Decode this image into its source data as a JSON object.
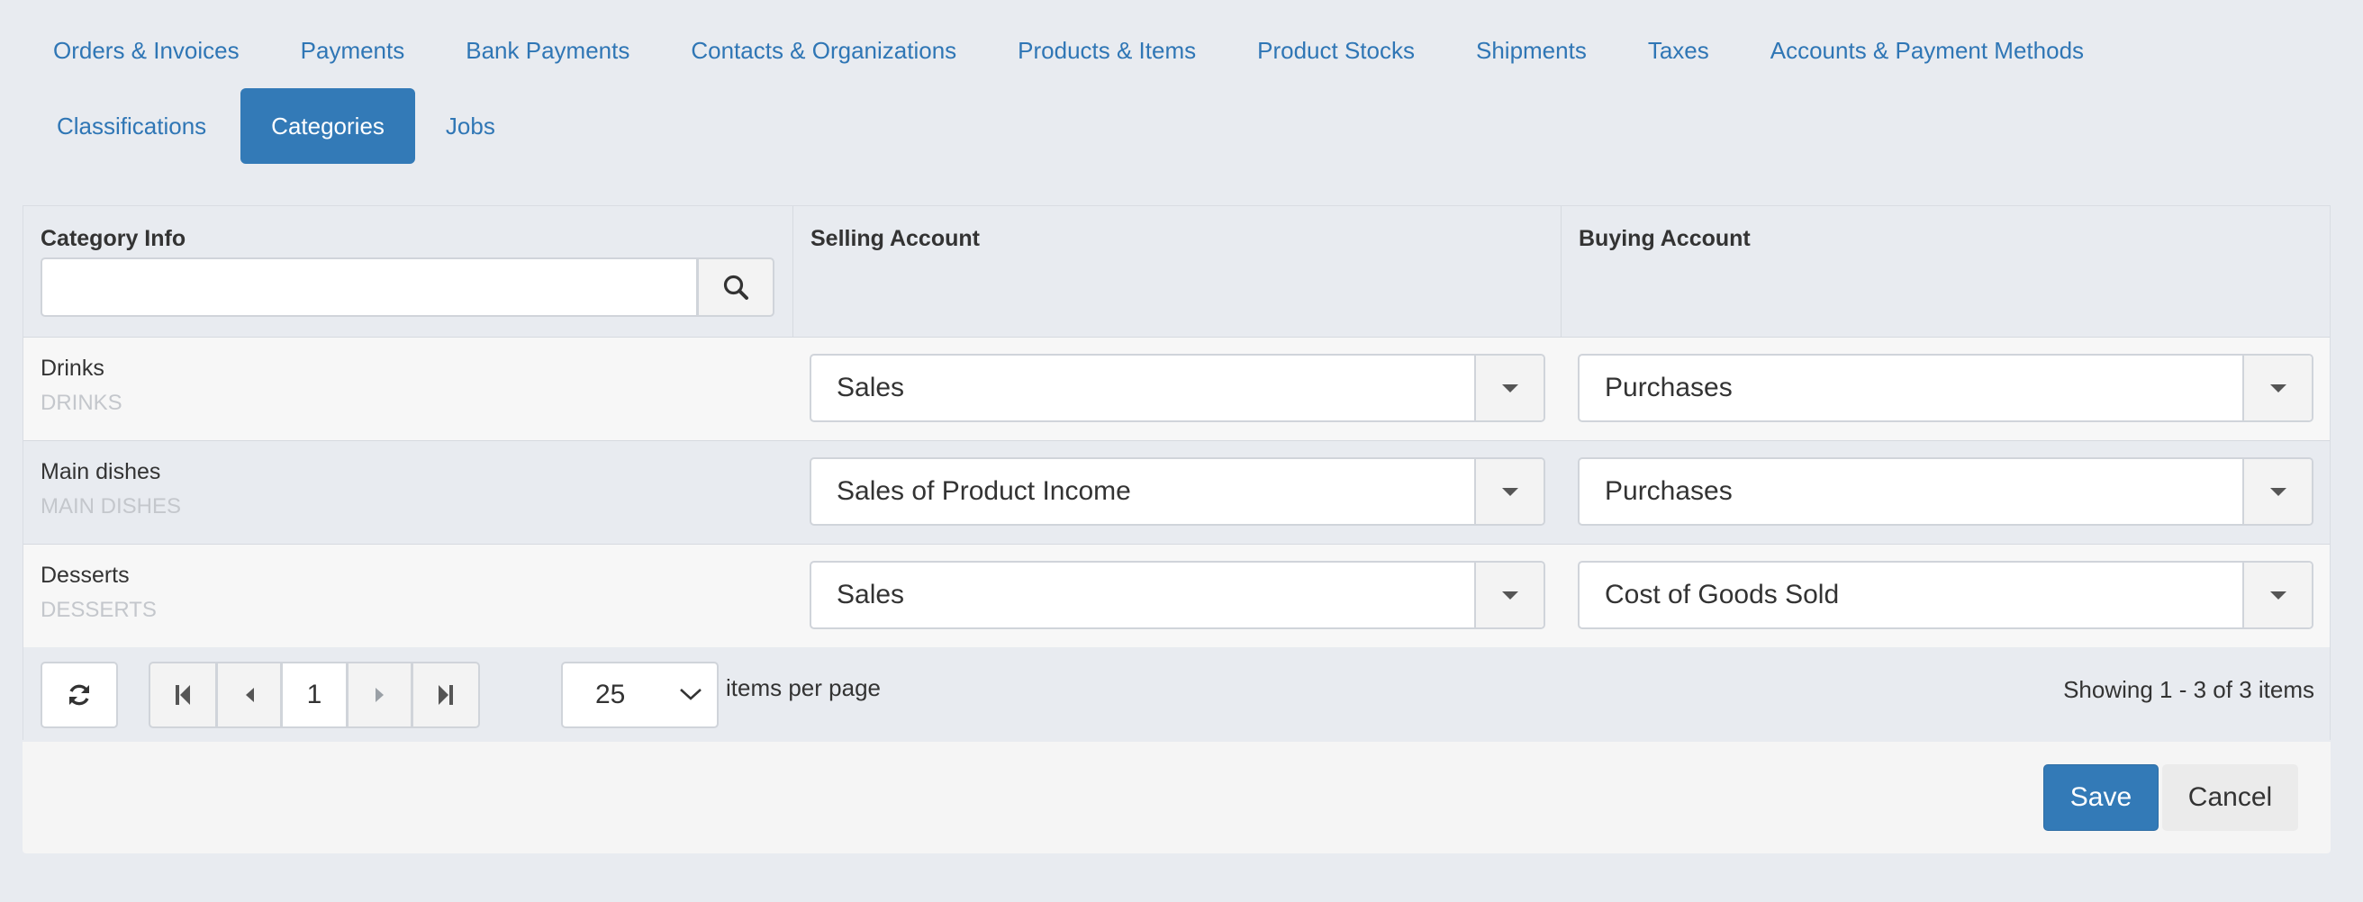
{
  "tabs": {
    "row1": [
      {
        "label": "Orders & Invoices"
      },
      {
        "label": "Payments"
      },
      {
        "label": "Bank Payments"
      },
      {
        "label": "Contacts & Organizations"
      },
      {
        "label": "Products & Items"
      },
      {
        "label": "Product Stocks"
      },
      {
        "label": "Shipments"
      },
      {
        "label": "Taxes"
      },
      {
        "label": "Accounts & Payment Methods"
      }
    ],
    "row2": [
      {
        "label": "Classifications"
      },
      {
        "label": "Categories",
        "active": true
      },
      {
        "label": "Jobs"
      }
    ]
  },
  "grid": {
    "columns": [
      {
        "label": "Category Info"
      },
      {
        "label": "Selling Account"
      },
      {
        "label": "Buying Account"
      }
    ],
    "filter": {
      "value": "",
      "placeholder": "",
      "icon": "search-icon"
    },
    "rows": [
      {
        "name": "Drinks",
        "code": "DRINKS",
        "selling": "Sales",
        "buying": "Purchases"
      },
      {
        "name": "Main dishes",
        "code": "MAIN DISHES",
        "selling": "Sales of Product Income",
        "buying": "Purchases"
      },
      {
        "name": "Desserts",
        "code": "DESSERTS",
        "selling": "Sales",
        "buying": "Cost of Goods Sold"
      }
    ]
  },
  "pager": {
    "refresh_icon": "refresh-icon",
    "current_page": "1",
    "page_size": "25",
    "items_per_page_label": "items per page",
    "showing_text": "Showing 1 - 3 of 3 items"
  },
  "footer": {
    "save_label": "Save",
    "cancel_label": "Cancel"
  },
  "colors": {
    "accent": "#337ab7",
    "link": "#2f76b5",
    "background": "#e8ebf0"
  }
}
